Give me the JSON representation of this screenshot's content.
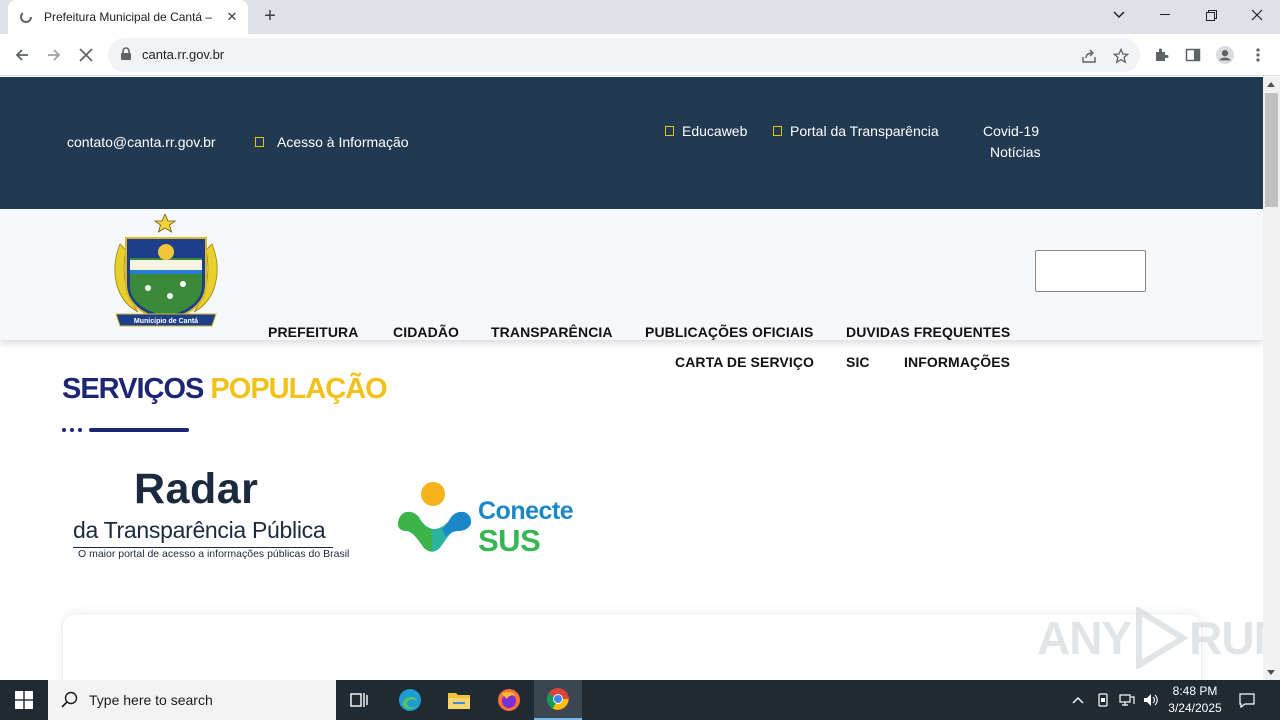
{
  "browser": {
    "tab_title": "Prefeitura Municipal de Cantá –",
    "new_tab_symbol": "+",
    "url": "canta.rr.gov.br"
  },
  "topbar": {
    "email": "contato@canta.rr.gov.br",
    "access_info": "Acesso à Informação",
    "educaweb": "Educaweb",
    "transparency_portal": "Portal da Transparência",
    "covid": "Covid-19",
    "news": "Notícias"
  },
  "logo": {
    "banner_text": "Município de Cantá"
  },
  "nav": {
    "prefeitura": "PREFEITURA",
    "cidadao": "CIDADÃO",
    "transparencia": "TRANSPARÊNCIA",
    "publicacoes": "PUBLICAÇÕES OFICIAIS",
    "duvidas": "DUVIDAS FREQUENTES",
    "carta": "CARTA DE SERVIÇO",
    "sic": "SIC",
    "informacoes": "INFORMAÇÕES"
  },
  "section": {
    "title_a": "SERVIÇOS",
    "title_b": "POPULAÇÃO"
  },
  "radar": {
    "line1": "Radar",
    "line2": "da Transparência Pública",
    "line3": "O maior portal de acesso a informações públicas do Brasil"
  },
  "conecte": {
    "line1": "Conecte",
    "line2": "SUS"
  },
  "watermark": {
    "left": "ANY",
    "right": "RUN"
  },
  "taskbar": {
    "search_placeholder": "Type here to search",
    "time": "8:48 PM",
    "date": "3/24/2025"
  },
  "colors": {
    "topbar_bg": "#213a52",
    "title_blue": "#1d2575",
    "title_yellow": "#f2c21b"
  }
}
